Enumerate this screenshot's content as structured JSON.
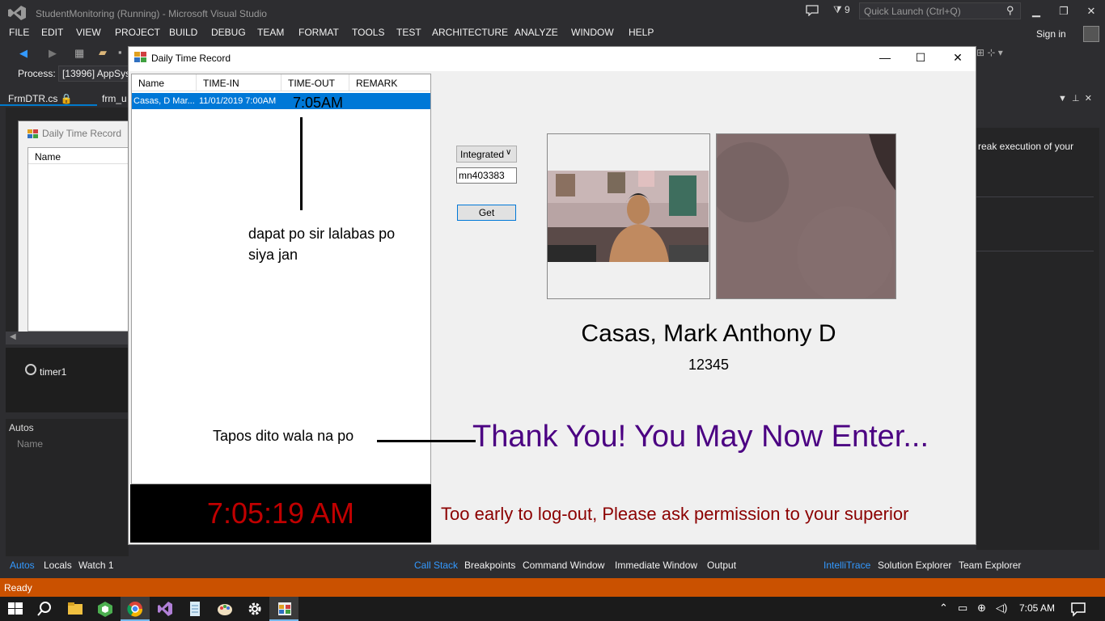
{
  "vs": {
    "title": "StudentMonitoring (Running) - Microsoft Visual Studio",
    "filter_count": "9",
    "quick_launch_placeholder": "Quick Launch (Ctrl+Q)",
    "menu": [
      "FILE",
      "EDIT",
      "VIEW",
      "PROJECT",
      "BUILD",
      "DEBUG",
      "TEAM",
      "FORMAT",
      "TOOLS",
      "TEST",
      "ARCHITECTURE",
      "ANALYZE",
      "WINDOW",
      "HELP"
    ],
    "sign_in": "Sign in",
    "process_label": "Process:",
    "process_value": "[13996] AppSys",
    "doc_tabs": [
      "FrmDTR.cs",
      "frm_u"
    ],
    "designer": {
      "form_title": "Daily Time Record",
      "grid_column": "Name",
      "tray_component": "timer1"
    },
    "autos": {
      "title": "Autos",
      "column": "Name"
    },
    "right_panel_text": "reak execution of your",
    "bottom_tabs_left": [
      "Autos",
      "Locals",
      "Watch 1"
    ],
    "bottom_tabs_mid": [
      "Call Stack",
      "Breakpoints",
      "Command Window",
      "Immediate Window",
      "Output"
    ],
    "bottom_tabs_right": [
      "IntelliTrace",
      "Solution Explorer",
      "Team Explorer"
    ],
    "status": "Ready"
  },
  "taskbar": {
    "time": "7:05 AM"
  },
  "dtr": {
    "title": "Daily Time Record",
    "columns": [
      "Name",
      "TIME-IN",
      "TIME-OUT",
      "REMARK"
    ],
    "rows": [
      {
        "name": "Casas, D Mar...",
        "time_in": "11/01/2019 7:00AM",
        "time_out": "7:05AM",
        "remark": ""
      }
    ],
    "annotation_1": "dapat po sir lalabas po siya jan",
    "annotation_2": "Tapos dito wala na po",
    "clock": "7:05:19 AM",
    "camera_option": "Integrated",
    "id_value": "mn403383",
    "get_label": "Get",
    "student_name": "Casas, Mark Anthony D",
    "student_id": "12345",
    "message_main": "Thank You! You May Now Enter...",
    "message_warn": "Too early to log-out, Please ask permission  to your  superior",
    "colors": {
      "clock_text": "#c00000",
      "message_main": "#4b0082",
      "message_warn": "#8b0000",
      "selection": "#0078d7"
    }
  }
}
